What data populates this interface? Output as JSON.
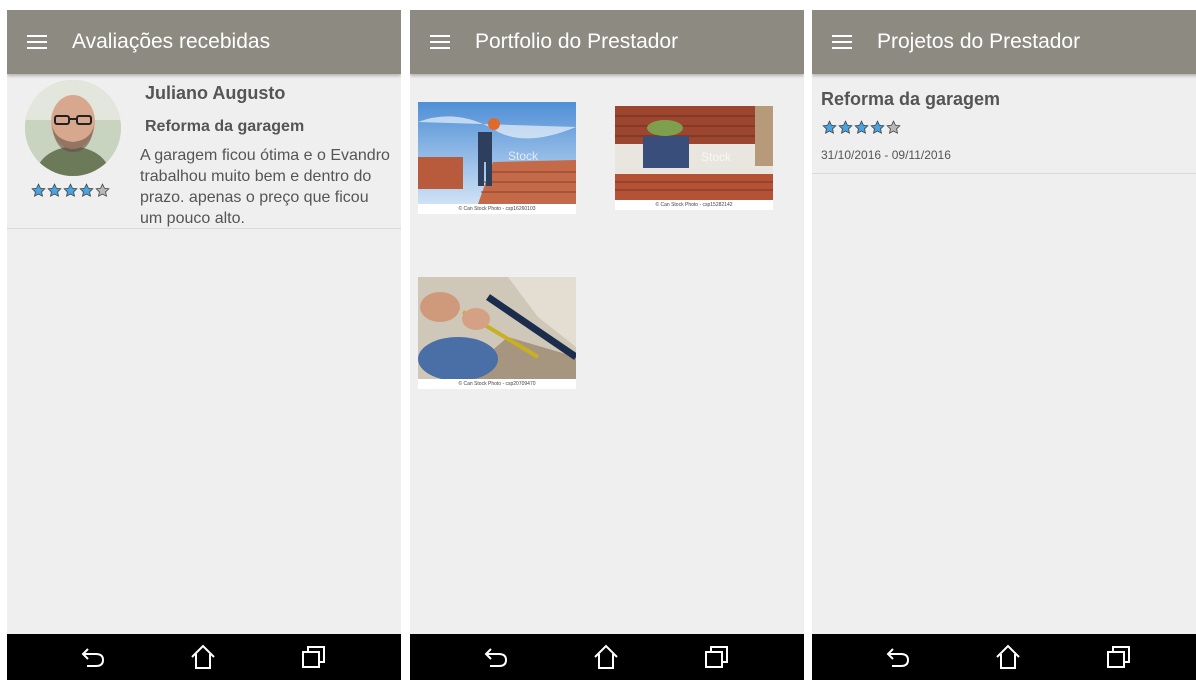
{
  "colors": {
    "appbar": "#8d8a82",
    "background": "#efefef",
    "star_filled": "#4aa3df",
    "star_empty": "#b8b8b8",
    "navbar": "#000000"
  },
  "icons": {
    "menu": "hamburger-menu-icon",
    "back": "back-arrow-icon",
    "home": "home-icon",
    "recent": "recent-apps-icon",
    "star": "star-icon"
  },
  "screens": [
    {
      "title": "Avaliações recebidas",
      "reviews": [
        {
          "reviewer": "Juliano Augusto",
          "project": "Reforma da garagem",
          "comment": "A garagem ficou ótima e o Evandro trabalhou muito bem e dentro do prazo. apenas o preço que ficou um pouco alto.",
          "rating": 4,
          "rating_max": 5
        }
      ]
    },
    {
      "title": "Portfolio do Prestador",
      "photos": [
        {
          "caption": "© Can Stock Photo - csp16260103",
          "watermark": "Stock"
        },
        {
          "caption": "© Can Stock Photo - csp15282142",
          "watermark": "Stock"
        },
        {
          "caption": "© Can Stock Photo - csp20709470",
          "watermark": ""
        }
      ]
    },
    {
      "title": "Projetos do Prestador",
      "projects": [
        {
          "name": "Reforma da garagem",
          "rating": 4,
          "rating_max": 5,
          "dates": "31/10/2016 - 09/11/2016"
        }
      ]
    }
  ]
}
